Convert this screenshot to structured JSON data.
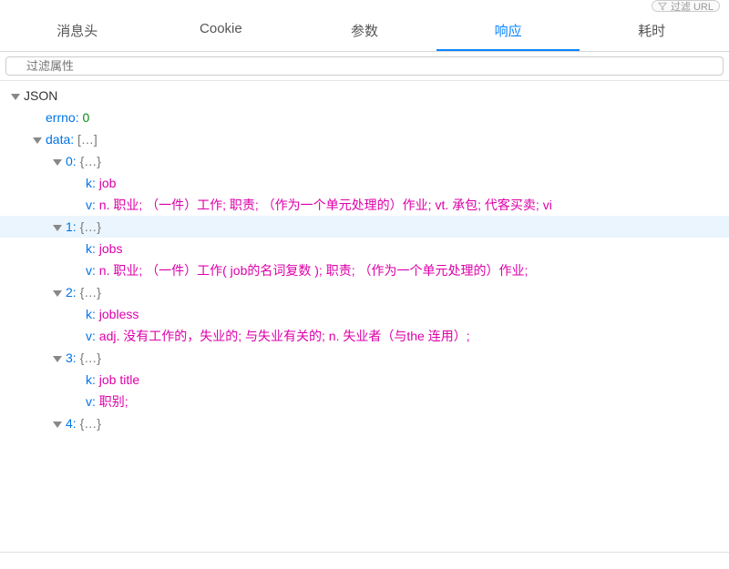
{
  "corner_text": "过滤 URL",
  "tabs": [
    {
      "label": "消息头"
    },
    {
      "label": "Cookie"
    },
    {
      "label": "参数"
    },
    {
      "label": "响应"
    },
    {
      "label": "耗时"
    }
  ],
  "active_tab_index": 3,
  "filter": {
    "placeholder": "过滤属性"
  },
  "root_label": "JSON",
  "json": {
    "errno_key": "errno",
    "errno_value": "0",
    "data_key": "data",
    "data_bracket": "[…]",
    "obj_bracket": "{…}",
    "items": [
      {
        "index": "0",
        "k_label": "k",
        "k_value": "job",
        "v_label": "v",
        "v_value": "n. 职业;  （一件）工作; 职责;  （作为一个单元处理的）作业; vt. 承包; 代客买卖; vi"
      },
      {
        "index": "1",
        "k_label": "k",
        "k_value": "jobs",
        "v_label": "v",
        "v_value": "n. 职业;  （一件）工作( job的名词复数 ); 职责;  （作为一个单元处理的）作业;"
      },
      {
        "index": "2",
        "k_label": "k",
        "k_value": "jobless",
        "v_label": "v",
        "v_value": "adj. 没有工作的，失业的; 与失业有关的; n. 失业者（与the 连用）;"
      },
      {
        "index": "3",
        "k_label": "k",
        "k_value": "job title",
        "v_label": "v",
        "v_value": "职别;"
      },
      {
        "index": "4",
        "k_label": "",
        "k_value": "",
        "v_label": "",
        "v_value": ""
      }
    ]
  }
}
